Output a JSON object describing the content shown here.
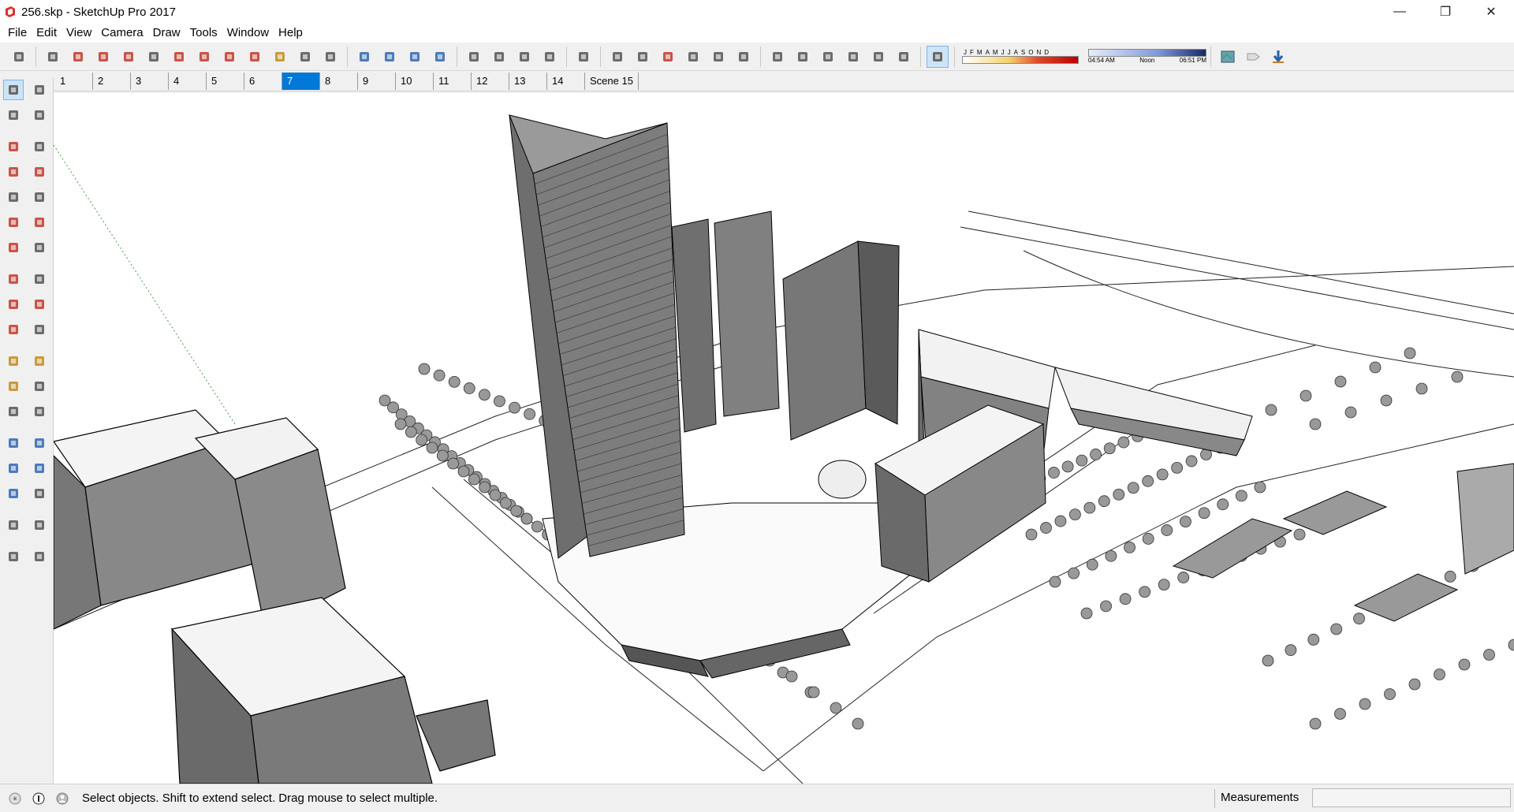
{
  "window": {
    "title": "256.skp - SketchUp Pro 2017",
    "minimize": "—",
    "restore": "❐",
    "close": "✕"
  },
  "menu": [
    "File",
    "Edit",
    "View",
    "Camera",
    "Draw",
    "Tools",
    "Window",
    "Help"
  ],
  "toolbar": {
    "icons": [
      "select-icon",
      "eraser-icon",
      "line-icon",
      "arc-icon",
      "rectangle-icon",
      "push-pull-icon",
      "follow-me-icon",
      "move-icon",
      "rotate-icon",
      "scale-icon",
      "tape-measure-icon",
      "text-icon",
      "paint-bucket-icon",
      "orbit-icon",
      "pan-icon",
      "zoom-icon",
      "zoom-extents-icon",
      "warehouse-icon",
      "extension-warehouse-icon",
      "layout-icon",
      "ruby-icon",
      "xray-icon",
      "back-edges-icon",
      "wireframe-icon",
      "hidden-line-icon",
      "shaded-icon",
      "shaded-textures-icon",
      "monochrome-icon",
      "iso-icon",
      "top-view-icon",
      "front-view-icon",
      "right-view-icon",
      "back-view-icon",
      "left-view-icon",
      "shadows-icon"
    ],
    "shadow_months": [
      "J",
      "F",
      "M",
      "A",
      "M",
      "J",
      "J",
      "A",
      "S",
      "O",
      "N",
      "D"
    ],
    "shadow_times": [
      "04:54 AM",
      "Noon",
      "06:51 PM"
    ]
  },
  "scenes": {
    "tabs": [
      "1",
      "2",
      "3",
      "4",
      "5",
      "6",
      "7",
      "8",
      "9",
      "10",
      "11",
      "12",
      "13",
      "14",
      "Scene 15"
    ],
    "active": "7"
  },
  "left_tools": [
    [
      "select-icon",
      "component-icon"
    ],
    [
      "paint-bucket-icon",
      "eraser-icon"
    ],
    [
      "pencil-icon",
      "freehand-icon"
    ],
    [
      "rectangle-icon",
      "rotated-rectangle-icon"
    ],
    [
      "circle-icon",
      "polygon-icon"
    ],
    [
      "arc-icon",
      "two-point-arc-icon"
    ],
    [
      "three-point-arc-icon",
      "pie-icon"
    ],
    [
      "move-icon",
      "push-pull-icon"
    ],
    [
      "rotate-icon",
      "follow-me-icon"
    ],
    [
      "scale-icon",
      "offset-icon"
    ],
    [
      "tape-measure-icon",
      "dimension-icon"
    ],
    [
      "protractor-icon",
      "text-icon"
    ],
    [
      "axes-icon",
      "3d-text-icon"
    ],
    [
      "orbit-icon",
      "pan-icon"
    ],
    [
      "zoom-icon",
      "zoom-window-icon"
    ],
    [
      "zoom-extents-icon",
      "previous-view-icon"
    ],
    [
      "position-camera-icon",
      "look-around-icon"
    ],
    [
      "walk-icon",
      "section-plane-icon"
    ]
  ],
  "status": {
    "message": "Select objects. Shift to extend select. Drag mouse to select multiple.",
    "measurements_label": "Measurements",
    "measurements_value": ""
  }
}
